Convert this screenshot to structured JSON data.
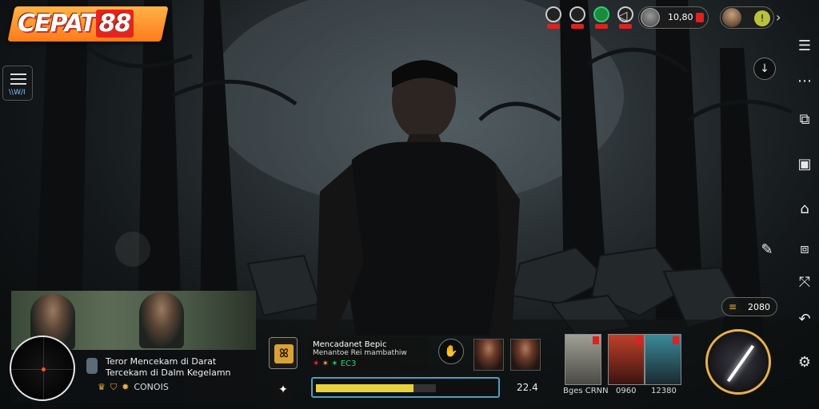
{
  "logo": {
    "text": "CEPAT",
    "num": "88"
  },
  "menu": {
    "tag": "\\\\W/I"
  },
  "top_bar": {
    "icons": [
      "badge-icon",
      "badge-icon",
      "leaf-icon",
      "gift-icon"
    ],
    "currency_value": "10,80",
    "player_lock": "!"
  },
  "sidebar": {
    "items": [
      "menu-icon",
      "more-icon",
      "gallery-icon",
      "square-icon",
      "home-icon",
      "copy-icon",
      "share-icon",
      "back-icon",
      "settings-icon"
    ]
  },
  "counter": {
    "value": "2080"
  },
  "video": {
    "line1": "Teror Mencekam di Darat",
    "line2": "Tercekam di Dalm Kegelamn",
    "stats": "CONOIS"
  },
  "mission": {
    "title": "Mencadanet Bepic",
    "subtitle": "Menantoe Rei mambathiw",
    "values": [
      "✶",
      "✶",
      "✶ EC3"
    ]
  },
  "hud": {
    "xp_value": "22.4",
    "xp_progress": 0.81
  },
  "cards": {
    "labels": [
      "Bges CRNN",
      "0960",
      "12380"
    ]
  }
}
